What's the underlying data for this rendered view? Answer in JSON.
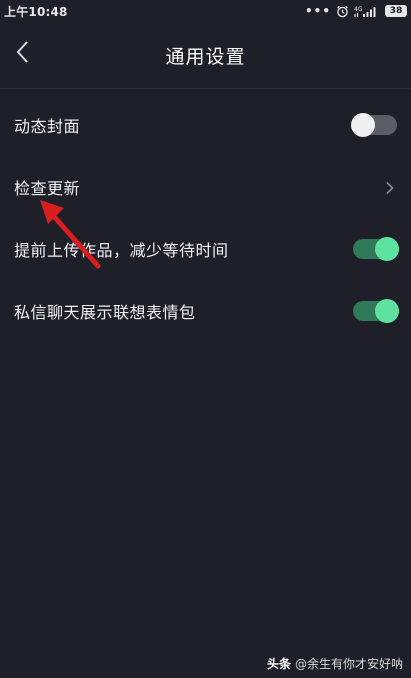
{
  "status_bar": {
    "time": "上午10:48",
    "dots": "•••",
    "signal_label": "4G",
    "battery": "38"
  },
  "header": {
    "title": "通用设置",
    "back_icon": "chevron-left-icon"
  },
  "settings": [
    {
      "label": "动态封面",
      "control": "toggle",
      "on": false
    },
    {
      "label": "检查更新",
      "control": "chevron"
    },
    {
      "label": "提前上传作品，减少等待时间",
      "control": "toggle",
      "on": true
    },
    {
      "label": "私信聊天展示联想表情包",
      "control": "toggle",
      "on": true
    }
  ],
  "colors": {
    "background": "#1e1f29",
    "toggle_on_knob": "#5ee2a0",
    "toggle_on_track": "#2f7a57",
    "toggle_off_track": "#5b5c66",
    "annotation": "#d81e1e"
  },
  "watermark": {
    "brand": "头条",
    "handle": "@余生有你才安好呐"
  }
}
